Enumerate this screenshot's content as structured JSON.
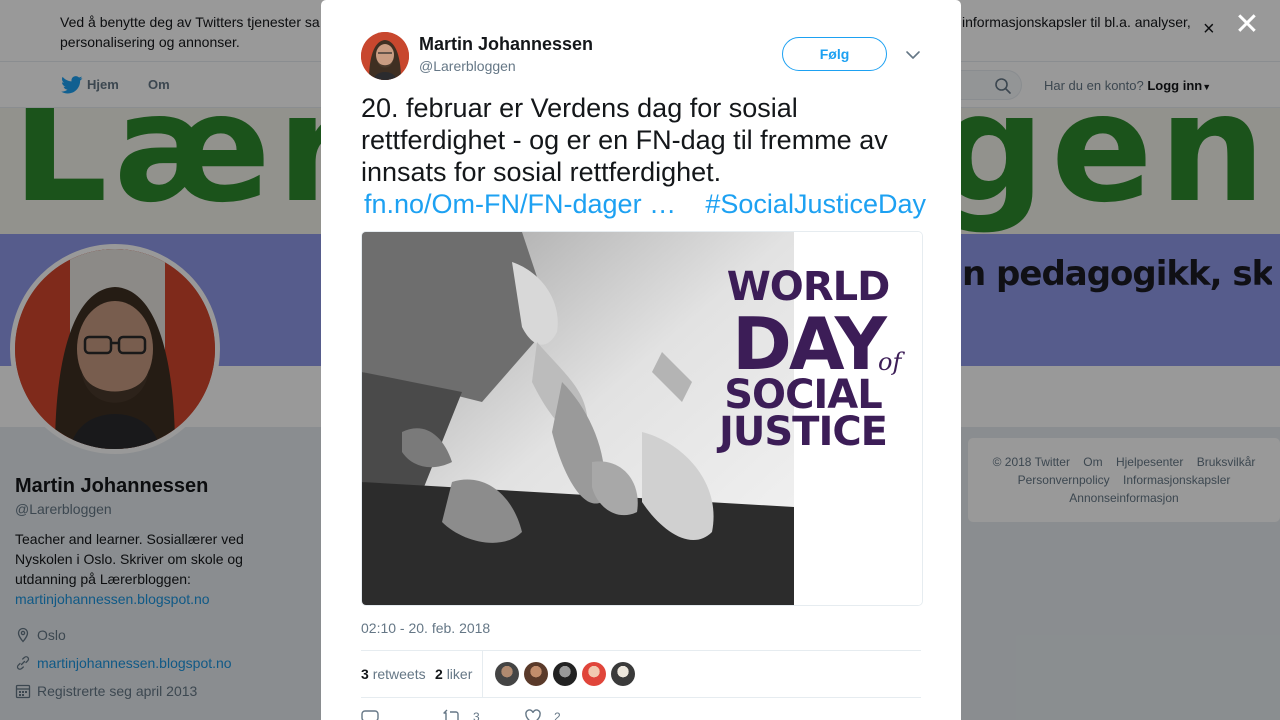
{
  "cookie_bar": {
    "text_left": "Ved å benytte deg av Twitters tjenester sa personalisering og annonser.",
    "text_right": "informasjonskapsler til bl.a. analyser,"
  },
  "nav": {
    "home": "Hjem",
    "about": "Om",
    "account_prompt": "Har du en konto?",
    "login": "Logg inn"
  },
  "banner": {
    "logo_text": "Lærerbloggen",
    "slogan": "n pedagogikk, skole, gi og undervisning."
  },
  "profile": {
    "name": "Martin Johannessen",
    "handle": "@Larerbloggen",
    "bio": "Teacher and learner. Sosiallærer ved Nyskolen i Oslo. Skriver om skole og utdanning på Lærerbloggen:",
    "bio_link": "martinjohannessen.blogspot.no",
    "location": "Oslo",
    "website": "martinjohannessen.blogspot.no",
    "joined": "Registrerte seg april 2013"
  },
  "footer": {
    "items": [
      "© 2018 Twitter",
      "Om",
      "Hjelpesenter",
      "Bruksvilkår",
      "Personvernpolicy",
      "Informasjonskapsler",
      "Annonseinformasjon"
    ]
  },
  "tweet": {
    "author_name": "Martin Johannessen",
    "author_handle": "@Larerbloggen",
    "follow_label": "Følg",
    "text": "20. februar er Verdens dag for sosial rettferdighet - og er en FN-dag til fremme av innsats for sosial rettferdighet.",
    "link": "fn.no/Om-FN/FN-dager",
    "ellipsis": "…",
    "hashtag": "#SocialJusticeDay",
    "media_title": {
      "line1": "WORLD",
      "line2": "DAY",
      "of": "of",
      "line3": "SOCIAL",
      "line4": "JUSTICE"
    },
    "timestamp": "02:10 - 20. feb. 2018",
    "retweets_count": "3",
    "retweets_label": "retweets",
    "likes_count": "2",
    "likes_label": "liker",
    "action_retweet_count": "3",
    "action_like_count": "2"
  },
  "colors": {
    "accent": "#1da1f2",
    "link": "#1b95e0",
    "title_purple": "#3c1d57"
  },
  "icons": {
    "close_overlay": "close-icon",
    "close_cookie": "close-icon",
    "twitter": "twitter-bird-icon",
    "search": "search-icon",
    "caret": "chevron-down-icon",
    "location": "location-pin-icon",
    "link": "link-icon",
    "calendar": "calendar-icon",
    "reply": "reply-icon",
    "retweet": "retweet-icon",
    "like": "heart-icon"
  }
}
